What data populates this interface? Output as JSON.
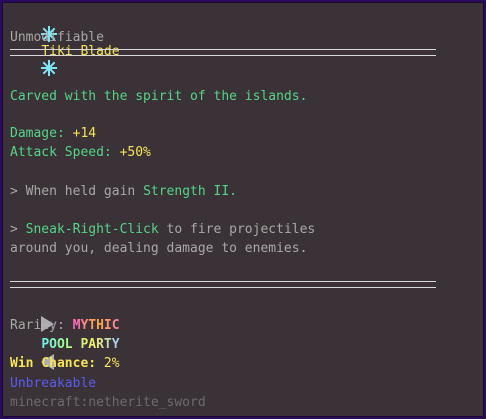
{
  "title": "Tiki Blade",
  "subtitle": "Unmodifiable",
  "lore": "Carved with the spirit of the islands.",
  "stats": [
    {
      "label": "Damage:",
      "value": "+14"
    },
    {
      "label": "Attack Speed:",
      "value": "+50%"
    }
  ],
  "ability1": {
    "prefix": "> When held gain ",
    "highlight": "Strength II."
  },
  "ability2": {
    "prefix": "> ",
    "highlight": "Sneak-Right-Click",
    "rest": " to fire projectiles",
    "line2": "around you, dealing damage to enemies."
  },
  "set_name": "POOL PARTY",
  "rarity_label": "Rarity:",
  "rarity_value": "MYTHIC",
  "win_label": "Win Chance:",
  "win_value": "2%",
  "unbreakable": "Unbreakable",
  "item_id": "minecraft:netherite_sword",
  "icons": {
    "title_left": "sun-icon",
    "title_right": "sun-icon",
    "set_left": "triangle-right-icon",
    "set_right": "triangle-left-icon"
  },
  "colors": {
    "green": "#55d48a",
    "yellow": "#f7e45a",
    "blue": "#5b5bf2",
    "background": "#3a3236",
    "border": "#2a0a5e"
  }
}
